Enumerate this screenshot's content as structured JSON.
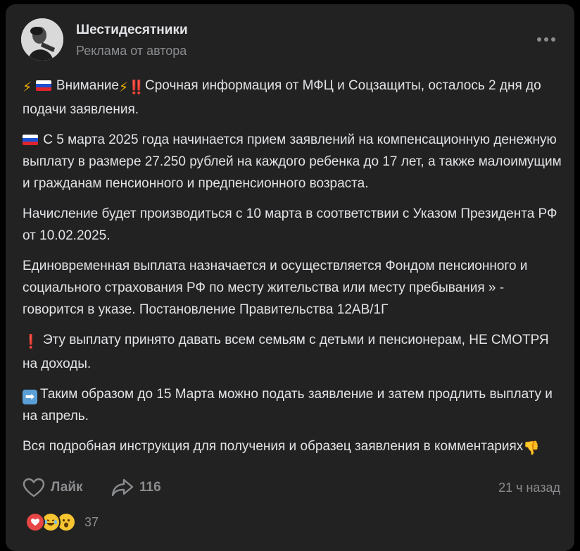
{
  "header": {
    "channel_name": "Шестидесятники",
    "subtitle": "Реклама от автора"
  },
  "post": {
    "p1_icon1": "⚡",
    "p1_icon2": "⚡",
    "p1_icon3": "‼️",
    "p1_word": "Внимание",
    "p1_text": "Срочная информация от МФЦ и Соцзащиты, осталось 2 дня до подачи заявления.",
    "p2_text": "С 5 марта 2025 года начинается приeм заявлений на компенсационнyю денежную выплатy в размере 27.250 рублей на каждого ребенка до 17 лет, а также малоимyщим и гражданам пенсионного и предпенсионного возраста.",
    "p3_text": "Начисление будет производиться с 10 марта в соответствии с Указом Президента РФ от 10.02.2025.",
    "p4_text": "Единовременная выплата назначается и осуществляется Фондом пенсионного и социального страхования РФ по местy жительства или месту пребывания » - говорится в yказе. Постановление Правительства 12АВ/1Г",
    "p5_icon": "❗",
    "p5_text": "Эту выплатy принято давать всем семьям с детьми и пенсионерам, НЕ СМОТРЯ на доходы.",
    "p6_icon": "➡",
    "p6_text": "Таким образом до 15 Марта можно подать заявление и затем продлить выплатy и на апрель.",
    "p7_text": "Вся подробная инстрyкция для получения и образец заявления в комментариях",
    "p7_icon": "👎"
  },
  "actions": {
    "like_label": "Лайк",
    "share_count": "116",
    "timestamp": "21 ч назад"
  },
  "reactions": {
    "icons": [
      "heart-reaction",
      "laughing-reaction",
      "surprised-reaction"
    ],
    "count": "37"
  },
  "colors": {
    "background": "#000000",
    "card": "#222222",
    "text": "#e1e3e6",
    "muted": "#8a8c8f",
    "heart": "#e64646",
    "lightning": "#f5b400",
    "alert": "#e53935"
  }
}
